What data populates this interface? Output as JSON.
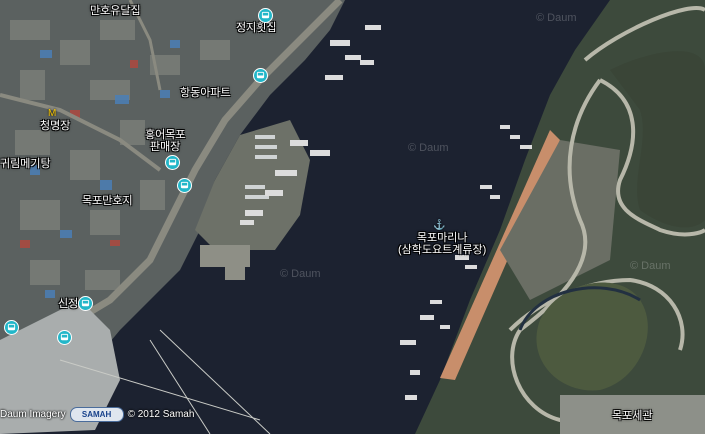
{
  "watermark_text": "© Daum",
  "labels": {
    "manhoyudal": "만호유달집",
    "jeongji": "정지횟집",
    "hangdong": "항동아파트",
    "cheongmyeong": "청명장",
    "hongeo_line1": "홍어목포",
    "hongeo_line2": "판매장",
    "mege": "귀림메기탕",
    "mokpo_manhoji": "목포만호지",
    "marina_line1": "목포마리나",
    "marina_line2": "(삼학도요트계류장)",
    "sinjeong": "신정",
    "customs": "목포세관"
  },
  "attribution": {
    "source": "Daum Imagery",
    "logo_text": "SAMAH",
    "copyright": "© 2012 Samah"
  },
  "icons": {
    "bus": "bus-stop-icon",
    "marina": "anchor-icon",
    "motel": "motel-icon"
  }
}
